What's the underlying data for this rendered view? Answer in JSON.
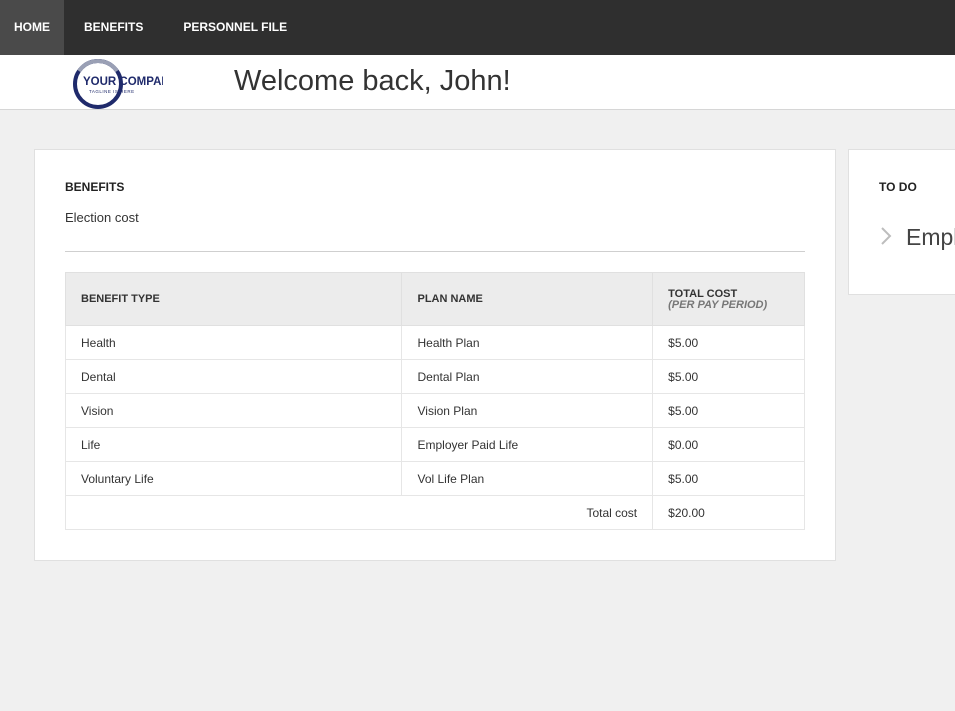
{
  "nav": {
    "items": [
      {
        "label": "HOME",
        "active": true
      },
      {
        "label": "BENEFITS",
        "active": false
      },
      {
        "label": "PERSONNEL FILE",
        "active": false
      }
    ]
  },
  "header": {
    "logo_text": "YOUR COMPANY",
    "logo_tagline": "TAGLINE IS HERE",
    "welcome": "Welcome back, John!"
  },
  "benefits": {
    "title": "BENEFITS",
    "subtitle": "Election cost",
    "columns": {
      "type": "BENEFIT TYPE",
      "plan": "PLAN NAME",
      "cost": "TOTAL COST",
      "cost_sub": "(PER PAY PERIOD)"
    },
    "rows": [
      {
        "type": "Health",
        "plan": "Health Plan",
        "cost": "$5.00"
      },
      {
        "type": "Dental",
        "plan": "Dental Plan",
        "cost": "$5.00"
      },
      {
        "type": "Vision",
        "plan": "Vision Plan",
        "cost": "$5.00"
      },
      {
        "type": "Life",
        "plan": "Employer Paid Life",
        "cost": "$0.00"
      },
      {
        "type": "Voluntary Life",
        "plan": "Vol Life Plan",
        "cost": "$5.00"
      }
    ],
    "total_label": "Total cost",
    "total_value": "$20.00"
  },
  "todo": {
    "title": "TO DO",
    "item": "Empl"
  },
  "colors": {
    "nav_bg": "#2f2f2f",
    "nav_active_bg": "#4a4a4a",
    "logo_navy": "#1f2a6b"
  }
}
